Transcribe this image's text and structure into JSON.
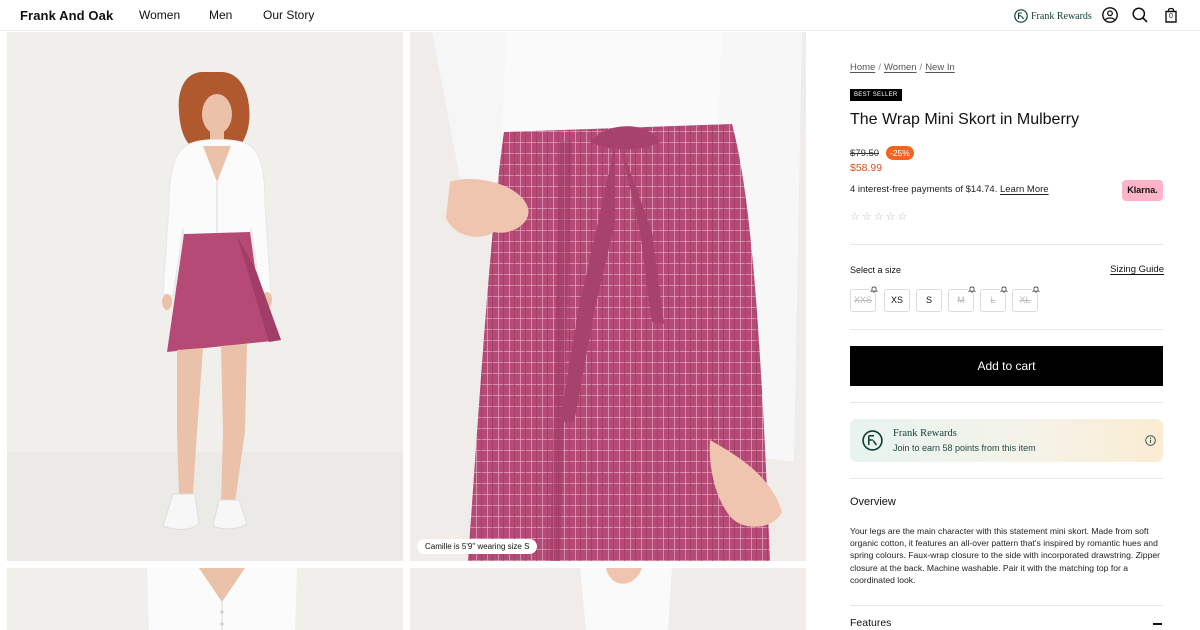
{
  "header": {
    "brand": "Frank And Oak",
    "nav": [
      "Women",
      "Men",
      "Our Story"
    ],
    "rewards_label": "Frank Rewards",
    "icons": [
      "frank-rewards-logo-icon",
      "account-icon",
      "search-icon",
      "bag-icon"
    ],
    "cart_count": "0"
  },
  "gallery": {
    "caption": "Camille is 5'9\" wearing size S"
  },
  "product": {
    "breadcrumb": [
      "Home",
      "Women",
      "New In"
    ],
    "badge": "BEST SELLER",
    "title": "The Wrap Mini Skort in Mulberry",
    "price_original": "$79.50",
    "discount": "-25%",
    "price_sale": "$58.99",
    "installments_text": "4 interest-free payments of $14.74.",
    "learn_more": "Learn More",
    "klarna_label": "Klarna.",
    "rating_stars": 0,
    "size_label": "Select a size",
    "sizing_guide": "Sizing Guide",
    "sizes": [
      {
        "label": "XXS",
        "available": false
      },
      {
        "label": "XS",
        "available": true
      },
      {
        "label": "S",
        "available": true
      },
      {
        "label": "M",
        "available": false
      },
      {
        "label": "L",
        "available": false
      },
      {
        "label": "XL",
        "available": false
      }
    ],
    "add_to_cart": "Add to cart"
  },
  "rewards_card": {
    "title": "Frank Rewards",
    "subtitle": "Join to earn 58 points from this item"
  },
  "overview": {
    "heading": "Overview",
    "text": "Your legs are the main character with this statement mini skort. Made from soft organic cotton, it features an all-over pattern that's inspired by romantic hues and spring colours. Faux-wrap closure to the side with incorporated drawstring. Zipper closure at the back. Machine washable. Pair it with the matching top for a coordinated look."
  },
  "features": {
    "heading": "Features"
  },
  "colors": {
    "accent_sale": "#d4541a",
    "discount_badge": "#f0651f",
    "skirt": "#b64a76",
    "klarna_pink": "#ffb3c7",
    "rewards_green": "#0f3e36"
  }
}
